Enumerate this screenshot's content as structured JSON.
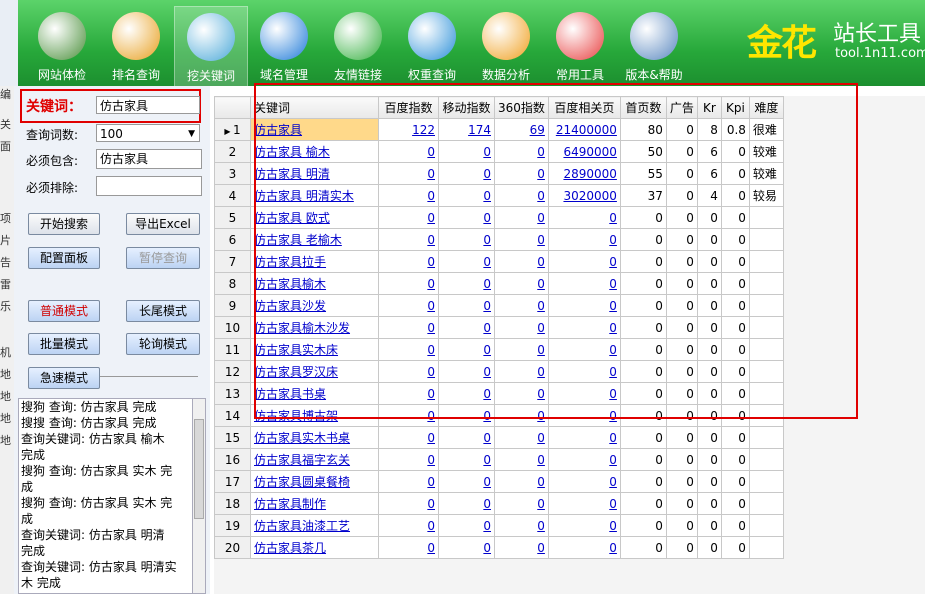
{
  "toolbar": {
    "items": [
      {
        "label": "网站体检",
        "icon": "website-check-icon"
      },
      {
        "label": "排名查询",
        "icon": "ranking-icon"
      },
      {
        "label": "挖关键词",
        "icon": "keyword-dig-icon"
      },
      {
        "label": "域名管理",
        "icon": "domain-ie-icon"
      },
      {
        "label": "友情链接",
        "icon": "friendlink-refresh-icon"
      },
      {
        "label": "权重查询",
        "icon": "weight-icon"
      },
      {
        "label": "数据分析",
        "icon": "data-analysis-icon"
      },
      {
        "label": "常用工具",
        "icon": "umbrella-tools-icon"
      },
      {
        "label": "版本&帮助",
        "icon": "help-book-icon"
      }
    ],
    "brand_main": "金花",
    "brand_sub": "站长工具",
    "brand_url": "tool.1n11.com"
  },
  "left_strip_chars": [
    "编",
    "关",
    "面",
    "项",
    "片",
    "告",
    "雷",
    "乐",
    "机",
    "地",
    "地",
    "地",
    "地"
  ],
  "form": {
    "keyword_label": "关键词：",
    "keyword_value": "仿古家具",
    "count_label": "查询词数:",
    "count_value": "100",
    "include_label": "必须包含:",
    "include_value": "仿古家具",
    "exclude_label": "必须排除:",
    "exclude_value": ""
  },
  "buttons": {
    "start": "开始搜索",
    "export": "导出Excel",
    "config": "配置面板",
    "pause": "暂停查询",
    "normal": "普通模式",
    "longtail": "长尾模式",
    "batch": "批量模式",
    "poll": "轮询模式",
    "urgent": "急速模式"
  },
  "log_lines": [
    "搜狗 查询: 仿古家具 完成",
    "搜搜 查询: 仿古家具 完成",
    "查询关键词: 仿古家具 榆木",
    "完成",
    "搜狗 查询: 仿古家具 实木 完",
    "成",
    "搜狗 查询: 仿古家具 实木 完",
    "成",
    "查询关键词: 仿古家具 明清",
    "完成",
    "查询关键词: 仿古家具 明清实",
    "木 完成"
  ],
  "table": {
    "headers": [
      "关键词",
      "百度指数",
      "移动指数",
      "360指数",
      "百度相关页",
      "首页数",
      "广告",
      "Kr",
      "Kpi",
      "难度"
    ],
    "rows": [
      {
        "n": "1",
        "kw": "仿古家具",
        "bd": "122",
        "mb": "174",
        "s3": "69",
        "rel": "21400000",
        "home": "80",
        "ad": "0",
        "kr": "8",
        "kpi": "0.8",
        "diff": "很难"
      },
      {
        "n": "2",
        "kw": "仿古家具 榆木",
        "bd": "0",
        "mb": "0",
        "s3": "0",
        "rel": "6490000",
        "home": "50",
        "ad": "0",
        "kr": "6",
        "kpi": "0",
        "diff": "较难"
      },
      {
        "n": "3",
        "kw": "仿古家具 明清",
        "bd": "0",
        "mb": "0",
        "s3": "0",
        "rel": "2890000",
        "home": "55",
        "ad": "0",
        "kr": "6",
        "kpi": "0",
        "diff": "较难"
      },
      {
        "n": "4",
        "kw": "仿古家具 明清实木",
        "bd": "0",
        "mb": "0",
        "s3": "0",
        "rel": "3020000",
        "home": "37",
        "ad": "0",
        "kr": "4",
        "kpi": "0",
        "diff": "较易"
      },
      {
        "n": "5",
        "kw": "仿古家具 欧式",
        "bd": "0",
        "mb": "0",
        "s3": "0",
        "rel": "0",
        "home": "0",
        "ad": "0",
        "kr": "0",
        "kpi": "0",
        "diff": ""
      },
      {
        "n": "6",
        "kw": "仿古家具 老榆木",
        "bd": "0",
        "mb": "0",
        "s3": "0",
        "rel": "0",
        "home": "0",
        "ad": "0",
        "kr": "0",
        "kpi": "0",
        "diff": ""
      },
      {
        "n": "7",
        "kw": "仿古家具拉手",
        "bd": "0",
        "mb": "0",
        "s3": "0",
        "rel": "0",
        "home": "0",
        "ad": "0",
        "kr": "0",
        "kpi": "0",
        "diff": ""
      },
      {
        "n": "8",
        "kw": "仿古家具榆木",
        "bd": "0",
        "mb": "0",
        "s3": "0",
        "rel": "0",
        "home": "0",
        "ad": "0",
        "kr": "0",
        "kpi": "0",
        "diff": ""
      },
      {
        "n": "9",
        "kw": "仿古家具沙发",
        "bd": "0",
        "mb": "0",
        "s3": "0",
        "rel": "0",
        "home": "0",
        "ad": "0",
        "kr": "0",
        "kpi": "0",
        "diff": ""
      },
      {
        "n": "10",
        "kw": "仿古家具榆木沙发",
        "bd": "0",
        "mb": "0",
        "s3": "0",
        "rel": "0",
        "home": "0",
        "ad": "0",
        "kr": "0",
        "kpi": "0",
        "diff": ""
      },
      {
        "n": "11",
        "kw": "仿古家具实木床",
        "bd": "0",
        "mb": "0",
        "s3": "0",
        "rel": "0",
        "home": "0",
        "ad": "0",
        "kr": "0",
        "kpi": "0",
        "diff": ""
      },
      {
        "n": "12",
        "kw": "仿古家具罗汉床",
        "bd": "0",
        "mb": "0",
        "s3": "0",
        "rel": "0",
        "home": "0",
        "ad": "0",
        "kr": "0",
        "kpi": "0",
        "diff": ""
      },
      {
        "n": "13",
        "kw": "仿古家具书桌",
        "bd": "0",
        "mb": "0",
        "s3": "0",
        "rel": "0",
        "home": "0",
        "ad": "0",
        "kr": "0",
        "kpi": "0",
        "diff": ""
      },
      {
        "n": "14",
        "kw": "仿古家具博古架",
        "bd": "0",
        "mb": "0",
        "s3": "0",
        "rel": "0",
        "home": "0",
        "ad": "0",
        "kr": "0",
        "kpi": "0",
        "diff": ""
      },
      {
        "n": "15",
        "kw": "仿古家具实木书桌",
        "bd": "0",
        "mb": "0",
        "s3": "0",
        "rel": "0",
        "home": "0",
        "ad": "0",
        "kr": "0",
        "kpi": "0",
        "diff": ""
      },
      {
        "n": "16",
        "kw": "仿古家具福字玄关",
        "bd": "0",
        "mb": "0",
        "s3": "0",
        "rel": "0",
        "home": "0",
        "ad": "0",
        "kr": "0",
        "kpi": "0",
        "diff": ""
      },
      {
        "n": "17",
        "kw": "仿古家具圆桌餐椅",
        "bd": "0",
        "mb": "0",
        "s3": "0",
        "rel": "0",
        "home": "0",
        "ad": "0",
        "kr": "0",
        "kpi": "0",
        "diff": ""
      },
      {
        "n": "18",
        "kw": "仿古家具制作",
        "bd": "0",
        "mb": "0",
        "s3": "0",
        "rel": "0",
        "home": "0",
        "ad": "0",
        "kr": "0",
        "kpi": "0",
        "diff": ""
      },
      {
        "n": "19",
        "kw": "仿古家具油漆工艺",
        "bd": "0",
        "mb": "0",
        "s3": "0",
        "rel": "0",
        "home": "0",
        "ad": "0",
        "kr": "0",
        "kpi": "0",
        "diff": ""
      },
      {
        "n": "20",
        "kw": "仿古家具茶几",
        "bd": "0",
        "mb": "0",
        "s3": "0",
        "rel": "0",
        "home": "0",
        "ad": "0",
        "kr": "0",
        "kpi": "0",
        "diff": ""
      }
    ],
    "selected_row": "1"
  },
  "colors": {
    "accent_red": "#e00000",
    "toolbar_green": "#27a83a",
    "link_blue": "#0000cc",
    "selected_row": "#ffd98a"
  }
}
